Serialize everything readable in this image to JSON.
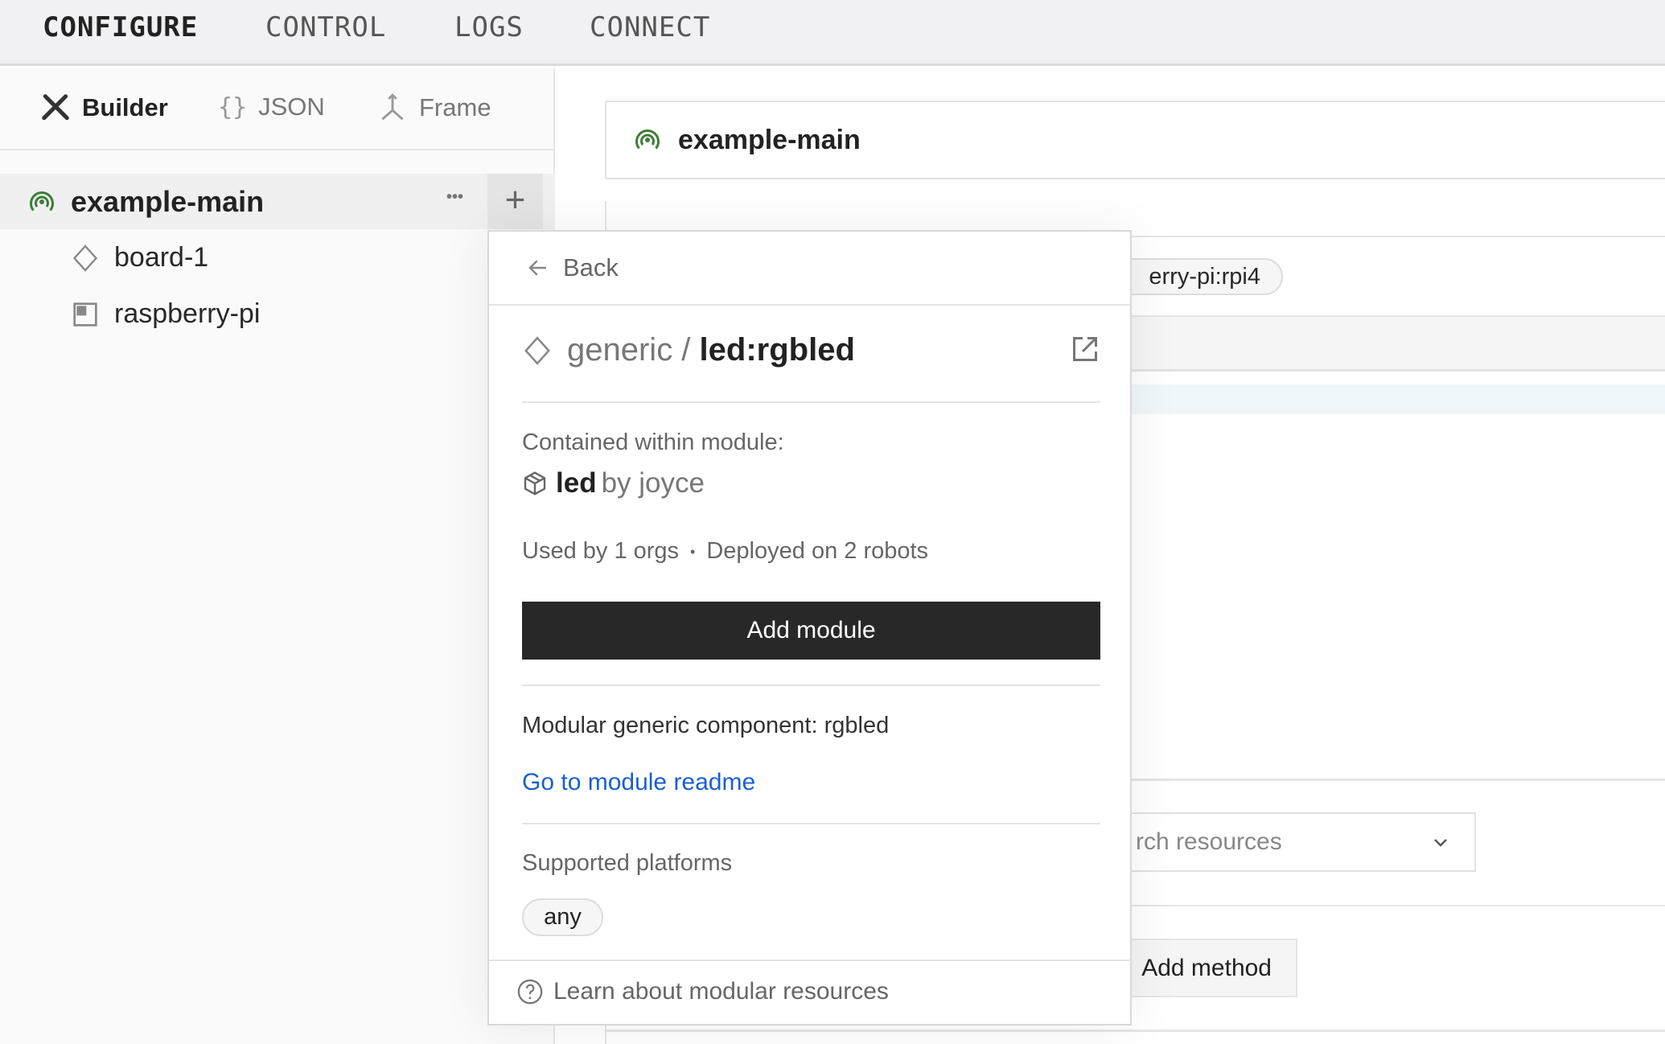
{
  "topnav": {
    "items": [
      {
        "label": "CONFIGURE",
        "active": true
      },
      {
        "label": "CONTROL"
      },
      {
        "label": "LOGS"
      },
      {
        "label": "CONNECT"
      }
    ]
  },
  "sidebar": {
    "tabs": [
      {
        "label": "Builder",
        "icon": "tools-icon",
        "active": true
      },
      {
        "label": "JSON",
        "icon": "braces-icon"
      },
      {
        "label": "Frame",
        "icon": "frame-axes-icon"
      }
    ],
    "machine": {
      "name": "example-main",
      "icon": "machine-signal-icon",
      "more_label": "•••",
      "add_label": "+"
    },
    "resources": [
      {
        "name": "board-1",
        "icon": "diamond-icon"
      },
      {
        "name": "raspberry-pi",
        "icon": "board-icon"
      }
    ]
  },
  "main": {
    "header_title": "example-main",
    "model_chip": "erry-pi:rpi4",
    "search_placeholder": "rch resources",
    "add_method_label": "Add method"
  },
  "popup": {
    "back_label": "Back",
    "namespace": "generic / ",
    "model": "led:rgbled",
    "contained_label": "Contained within module:",
    "module_name": "led",
    "module_author": "by joyce",
    "usage": "Used by 1 orgs",
    "separator": "•",
    "deployed": "Deployed on 2 robots",
    "add_module_label": "Add module",
    "description": "Modular generic component: rgbled",
    "readme_link": "Go to module readme",
    "platforms_label": "Supported platforms",
    "platforms": [
      "any"
    ],
    "learn_label": "Learn about modular resources"
  },
  "colors": {
    "accent_green": "#3f7d3a",
    "link_blue": "#1a5fcf",
    "button_dark": "#282828"
  }
}
